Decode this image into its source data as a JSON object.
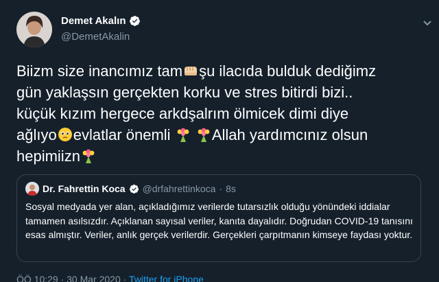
{
  "author": {
    "name": "Demet Akalın",
    "handle": "@DemetAkalin"
  },
  "tweet": {
    "line1_a": "Biizm size inancımız tam",
    "line1_b": "şu ilacıda bulduk dediğimz",
    "line2": "gün yaklaşsın gerçekten korku ve stres bitirdi bizi..",
    "line3": "küçük kızım hergece arkdşalrım ölmicek dimi diye",
    "line4_a": "ağlıyo",
    "line4_b": "evlatlar önemli",
    "line4_c": "Allah yardımcınız olsun",
    "line5": "hepimiizn",
    "emojis": [
      "oncoming-fist",
      "pleading-face",
      "tulip-bouquet"
    ]
  },
  "quote": {
    "name": "Dr. Fahrettin Koca",
    "handle": "@drfahrettinkoca",
    "dot": "·",
    "time": "8s",
    "text": "Sosyal medyada yer alan, açıkladığımız verilerde tutarsızlık olduğu yönündeki iddialar tamamen asılsızdır. Açıklanan sayısal veriler, kanıta dayalıdır. Doğrudan COVID-19 tanısını esas almıştır. Veriler, anlık gerçek verilerdir. Gerçekleri çarpıtmanın kimseye faydası yoktur."
  },
  "footer": {
    "timestamp": "ÖÖ 10:29 · 30 Mar 2020 ·",
    "source": "Twitter for iPhone"
  },
  "colors": {
    "background": "#15202b",
    "secondary_text": "#8899a6",
    "link": "#1da1f2",
    "verified": "#1da1f2",
    "border": "#38444d"
  }
}
